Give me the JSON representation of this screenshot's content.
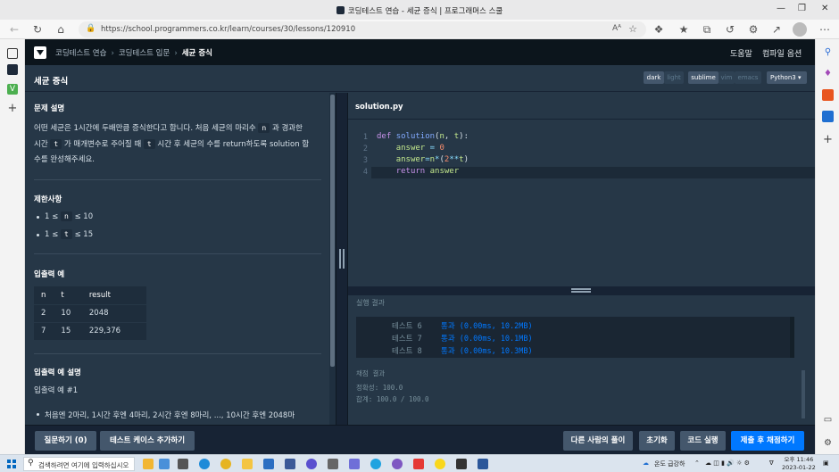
{
  "browser": {
    "window_title": "코딩테스트 연습 - 세균 증식 | 프로그래머스 스쿨",
    "url": "https://school.programmers.co.kr/learn/courses/30/lessons/120910",
    "url_right_text": "Aᴬ"
  },
  "app": {
    "breadcrumb": [
      "코딩테스트 연습",
      "코딩테스트 입문",
      "세균 증식"
    ],
    "help_link": "도움말",
    "compile_options": "컴파일 옵션",
    "problem_title": "세균 증식",
    "theme_toggles": [
      "dark",
      "light"
    ],
    "keymap_toggles": [
      "sublime",
      "vim",
      "emacs"
    ],
    "language": "Python3"
  },
  "problem": {
    "desc_heading": "문제 설명",
    "desc_line1_a": "어떤 세균은 1시간에 두배만큼 증식한다고 합니다. 처음 세균의 마리수",
    "var_n": "n",
    "desc_line1_b": "과 경과한",
    "desc_line2_a": "시간",
    "var_t": "t",
    "desc_line2_b": "가 매개변수로 주어질 때",
    "desc_line2_c": "시간 후 세균의 수를 return하도록 solution 함",
    "desc_line3": "수를 완성해주세요.",
    "limits_heading": "제한사항",
    "limit1_a": "1 ≤",
    "limit1_b": "≤ 10",
    "limit2_a": "1 ≤",
    "limit2_b": "≤ 15",
    "io_heading": "입출력 예",
    "table": {
      "headers": [
        "n",
        "t",
        "result"
      ],
      "rows": [
        [
          "2",
          "10",
          "2048"
        ],
        [
          "7",
          "15",
          "229,376"
        ]
      ]
    },
    "io_desc_heading": "입출력 예 설명",
    "io_example1": "입출력 예 #1",
    "io_example1_item": "처음엔 2마리, 1시간 후엔 4마리, 2시간 후엔 8마리, ..., 10시간 후엔 2048마"
  },
  "editor": {
    "filename": "solution.py",
    "line_numbers": [
      "1",
      "2",
      "3",
      "4"
    ]
  },
  "result": {
    "title": "실행 결과",
    "tests": [
      {
        "label": "테스트 6",
        "status": "통과 (0.00ms, 10.2MB)"
      },
      {
        "label": "테스트 7",
        "status": "통과 (0.00ms, 10.1MB)"
      },
      {
        "label": "테스트 8",
        "status": "통과 (0.00ms, 10.3MB)"
      }
    ],
    "grading_title": "채점 결과",
    "accuracy": "정확성: 100.0",
    "total": "합계: 100.0 / 100.0"
  },
  "footer": {
    "ask": "질문하기 (0)",
    "add_testcase": "테스트 케이스 추가하기",
    "others_solution": "다른 사람의 풀이",
    "reset": "초기화",
    "run": "코드 실행",
    "submit": "제출 후 채점하기"
  },
  "taskbar": {
    "search_placeholder": "검색하려면 여기에 입력하십시오",
    "weather": "온도 급강하",
    "time": "오후 11:46",
    "date": "2023-01-22"
  }
}
